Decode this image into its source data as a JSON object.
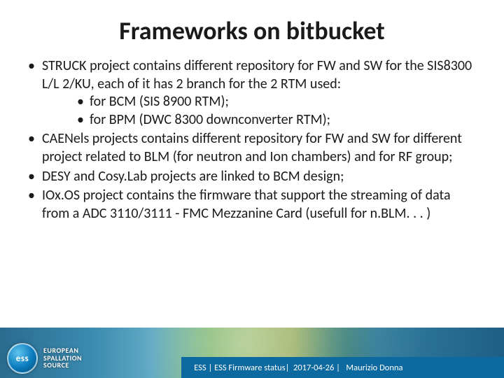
{
  "title": "Frameworks on bitbucket",
  "bullets": {
    "b1": "STRUCK project contains different repository for FW and SW for the SIS8300 L/L 2/KU, each of it has 2 branch for the 2 RTM used:",
    "b1a": "for BCM (SIS 8900 RTM);",
    "b1b": "for BPM (DWC 8300 downconverter RTM);",
    "b2": "CAENels projects contains different repository for FW and SW for different project related to BLM (for neutron and Ion chambers) and for RF group;",
    "b3": "DESY and Cosy.Lab projects are linked to BCM design;",
    "b4": "IOx.OS project contains the firmware that support the streaming of data from a ADC 3110/3111 - FMC Mezzanine Card (usefull for n.BLM. . . )"
  },
  "footer": {
    "org": "ESS",
    "doc": "ESS Firmware status",
    "date": "2017-04-26",
    "author": "Maurizio Donna"
  },
  "logo": {
    "abbr": "ess",
    "line1": "EUROPEAN",
    "line2": "SPALLATION",
    "line3": "SOURCE"
  }
}
